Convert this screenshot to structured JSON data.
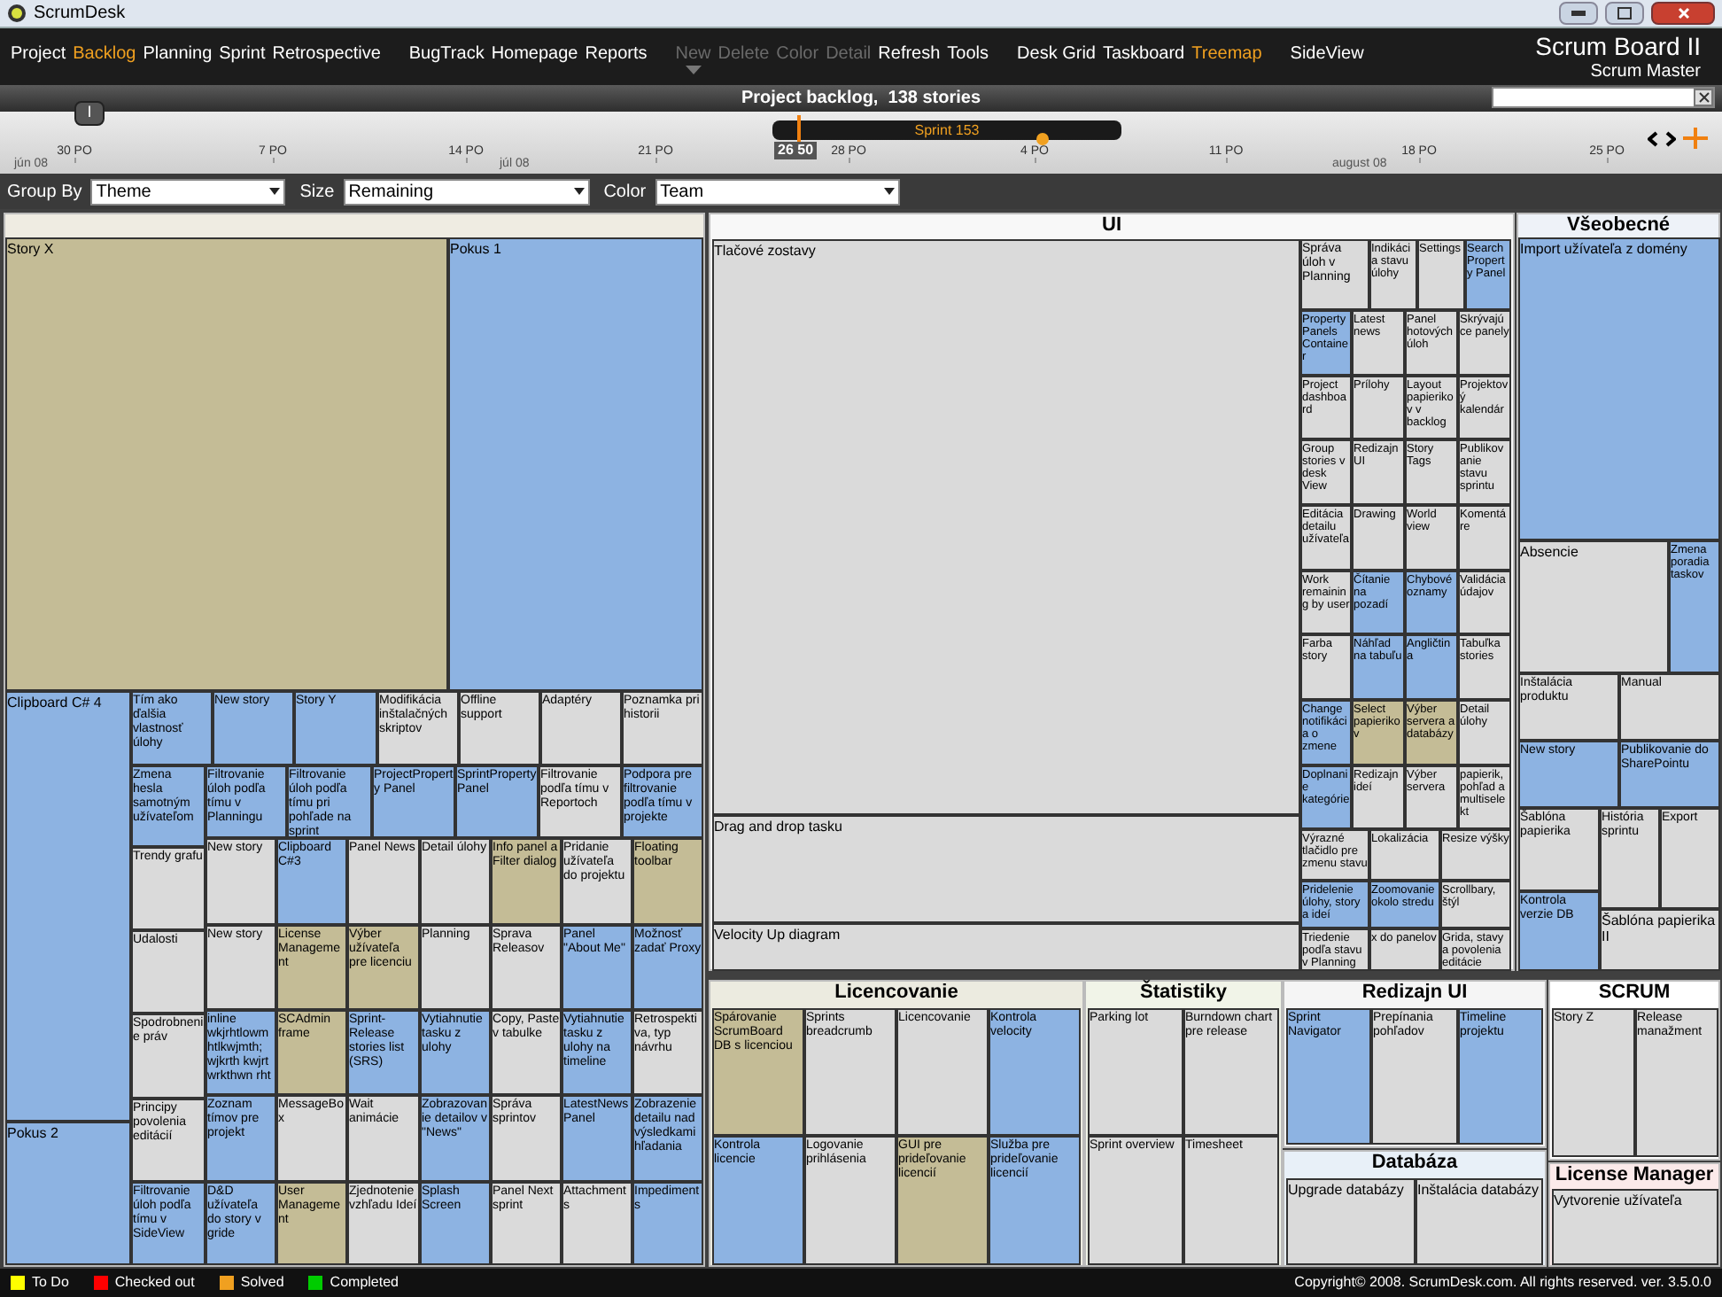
{
  "window": {
    "title": "ScrumDesk"
  },
  "menu": {
    "groups": [
      [
        {
          "label": "Project",
          "selected": false,
          "disabled": false
        },
        {
          "label": "Backlog",
          "selected": true,
          "disabled": false
        },
        {
          "label": "Planning",
          "selected": false,
          "disabled": false
        },
        {
          "label": "Sprint",
          "selected": false,
          "disabled": false
        },
        {
          "label": "Retrospective",
          "selected": false,
          "disabled": false
        }
      ],
      [
        {
          "label": "BugTrack",
          "selected": false,
          "disabled": false
        },
        {
          "label": "Homepage",
          "selected": false,
          "disabled": false
        },
        {
          "label": "Reports",
          "selected": false,
          "disabled": false
        }
      ],
      [
        {
          "label": "New",
          "selected": false,
          "disabled": true
        },
        {
          "label": "Delete",
          "selected": false,
          "disabled": true
        },
        {
          "label": "Color",
          "selected": false,
          "disabled": true
        },
        {
          "label": "Detail",
          "selected": false,
          "disabled": true
        },
        {
          "label": "Refresh",
          "selected": false,
          "disabled": false
        },
        {
          "label": "Tools",
          "selected": false,
          "disabled": false
        }
      ],
      [
        {
          "label": "Desk Grid",
          "selected": false,
          "disabled": false
        },
        {
          "label": "Taskboard",
          "selected": false,
          "disabled": false
        },
        {
          "label": "Treemap",
          "selected": true,
          "disabled": false
        }
      ],
      [
        {
          "label": "SideView",
          "selected": false,
          "disabled": false
        }
      ]
    ]
  },
  "board": {
    "title": "Scrum Board II",
    "role": "Scrum Master"
  },
  "backlog_header": {
    "title": "Project backlog,  138 stories"
  },
  "timeline": {
    "dates": [
      "30 PO",
      "7 PO",
      "14 PO",
      "21 PO",
      "28 PO",
      "4 PO",
      "11 PO",
      "18 PO",
      "25 PO"
    ],
    "months": [
      "jún 08",
      "júl 08",
      "august 08"
    ],
    "today": "26 50",
    "sprint": "Sprint 153",
    "handle": "I"
  },
  "toolbar": [
    {
      "label": "Group By",
      "value": "Theme"
    },
    {
      "label": "Size",
      "value": "Remaining"
    },
    {
      "label": "Color",
      "value": "Team"
    }
  ],
  "treemap": {
    "groups": [
      {
        "tiles": [
          {
            "label": "Story X",
            "color": "#c4bc96"
          },
          {
            "label": "Pokus 1",
            "color": "#8db3e2"
          },
          {
            "label": "Clipboard C# 4",
            "color": "#8db3e2"
          },
          {
            "label": "Pokus 2",
            "color": "#8db3e2"
          },
          {
            "label": "Tím ako ďalšia vlastnosť úlohy",
            "color": "#8db3e2"
          },
          {
            "label": "New story",
            "color": "#8db3e2"
          },
          {
            "label": "Story Y",
            "color": "#8db3e2"
          },
          {
            "label": "Modifikácia inštalačných skriptov",
            "color": "#dadada"
          },
          {
            "label": "Offline support",
            "color": "#dadada"
          },
          {
            "label": "Adaptéry",
            "color": "#dadada"
          },
          {
            "label": "Poznamka pri historii",
            "color": "#dadada"
          },
          {
            "label": "Zmena hesla samotným užívateľom",
            "color": "#8db3e2"
          },
          {
            "label": "Filtrovanie úloh podľa tímu v Planningu",
            "color": "#8db3e2"
          },
          {
            "label": "Filtrovanie úloh podľa tímu pri pohľade na sprint",
            "color": "#8db3e2"
          },
          {
            "label": "ProjectProperty Panel",
            "color": "#8db3e2"
          },
          {
            "label": "SprintProperty Panel",
            "color": "#8db3e2"
          },
          {
            "label": "Filtrovanie podľa tímu v Reportoch",
            "color": "#dadada"
          },
          {
            "label": "Podpora pre filtrovanie podľa tímu v projekte",
            "color": "#8db3e2"
          },
          {
            "label": "Trendy grafu",
            "color": "#dadada"
          },
          {
            "label": "Udalosti",
            "color": "#dadada"
          },
          {
            "label": "Spodrobnenie práv",
            "color": "#dadada"
          },
          {
            "label": "Principy povolenia editácií",
            "color": "#dadada"
          },
          {
            "label": "Filtrovanie úloh podľa tímu v SideView",
            "color": "#8db3e2"
          },
          {
            "label": "New story",
            "color": "#dadada"
          },
          {
            "label": "Clipboard C#3",
            "color": "#8db3e2"
          },
          {
            "label": "Panel News",
            "color": "#dadada"
          },
          {
            "label": "Detail úlohy",
            "color": "#dadada"
          },
          {
            "label": "Info panel a Filter dialog",
            "color": "#c4bc96"
          },
          {
            "label": "Pridanie užívateľa do projektu",
            "color": "#dadada"
          },
          {
            "label": "Floating toolbar",
            "color": "#c4bc96"
          },
          {
            "label": "New story",
            "color": "#dadada"
          },
          {
            "label": "License Management",
            "color": "#c4bc96"
          },
          {
            "label": "Výber užívateľa pre licenciu",
            "color": "#c4bc96"
          },
          {
            "label": "Planning",
            "color": "#dadada"
          },
          {
            "label": "Sprava Releasov",
            "color": "#dadada"
          },
          {
            "label": "Panel \"About Me\"",
            "color": "#8db3e2"
          },
          {
            "label": "Možnosť zadať Proxy",
            "color": "#8db3e2"
          },
          {
            "label": "inline wkjrhtlowmhtlkwjmth; wjkrth kwjrt wrkthwn rht",
            "color": "#8db3e2"
          },
          {
            "label": "SCAdmin frame",
            "color": "#c4bc96"
          },
          {
            "label": "Sprint-Release stories list (SRS)",
            "color": "#8db3e2"
          },
          {
            "label": "Vytiahnutie tasku z ulohy",
            "color": "#8db3e2"
          },
          {
            "label": "Copy, Paste v tabulke",
            "color": "#dadada"
          },
          {
            "label": "Vytiahnutie tasku z ulohy na timeline",
            "color": "#8db3e2"
          },
          {
            "label": "Retrospektiva, typ návrhu",
            "color": "#dadada"
          },
          {
            "label": "Zoznam tímov pre projekt",
            "color": "#8db3e2"
          },
          {
            "label": "MessageBox",
            "color": "#dadada"
          },
          {
            "label": "Wait animácie",
            "color": "#dadada"
          },
          {
            "label": "Zobrazovanie detailov v \"News\"",
            "color": "#8db3e2"
          },
          {
            "label": "Správa sprintov",
            "color": "#dadada"
          },
          {
            "label": "LatestNewsPanel",
            "color": "#8db3e2"
          },
          {
            "label": "Zobrazenie detailu nad výsledkami hľadania",
            "color": "#8db3e2"
          },
          {
            "label": "D&D užívateľa do story v gride",
            "color": "#8db3e2"
          },
          {
            "label": "User Management",
            "color": "#c4bc96"
          },
          {
            "label": "Zjednotenie vzhľadu Ideí",
            "color": "#dadada"
          },
          {
            "label": "Splash Screen",
            "color": "#8db3e2"
          },
          {
            "label": "Panel Next sprint",
            "color": "#dadada"
          },
          {
            "label": "Attachments",
            "color": "#dadada"
          },
          {
            "label": "Impediments",
            "color": "#8db3e2"
          }
        ]
      },
      {
        "title": "UI",
        "tiles": [
          {
            "label": "Tlačové zostavy",
            "color": "#dadada"
          },
          {
            "label": "Drag and drop tasku",
            "color": "#dadada"
          },
          {
            "label": "Velocity Up diagram",
            "color": "#dadada"
          },
          {
            "label": "Správa úloh v Planning",
            "color": "#dadada"
          },
          {
            "label": "Indikácia stavu úlohy",
            "color": "#dadada"
          },
          {
            "label": "Settings",
            "color": "#dadada"
          },
          {
            "label": "Search Property Panel",
            "color": "#8db3e2"
          },
          {
            "label": "Property Panels Container",
            "color": "#8db3e2"
          },
          {
            "label": "Latest news",
            "color": "#dadada"
          },
          {
            "label": "Panel hotových úloh",
            "color": "#dadada"
          },
          {
            "label": "Skrývajúce panely",
            "color": "#dadada"
          },
          {
            "label": "Project dashboard",
            "color": "#dadada"
          },
          {
            "label": "Prílohy",
            "color": "#dadada"
          },
          {
            "label": "Layout papierikov v backlog",
            "color": "#dadada"
          },
          {
            "label": "Projektový kalendár",
            "color": "#dadada"
          },
          {
            "label": "Group stories v desk View",
            "color": "#dadada"
          },
          {
            "label": "Redizajn UI",
            "color": "#dadada"
          },
          {
            "label": "Story Tags",
            "color": "#dadada"
          },
          {
            "label": "Publikovanie stavu sprintu",
            "color": "#dadada"
          },
          {
            "label": "Editácia detailu užívateľa",
            "color": "#dadada"
          },
          {
            "label": "Drawing",
            "color": "#dadada"
          },
          {
            "label": "World view",
            "color": "#dadada"
          },
          {
            "label": "Komentáre",
            "color": "#dadada"
          },
          {
            "label": "Work remaining by user",
            "color": "#dadada"
          },
          {
            "label": "Čítanie na pozadí",
            "color": "#8db3e2"
          },
          {
            "label": "Chybové oznamy",
            "color": "#8db3e2"
          },
          {
            "label": "Validácia údajov",
            "color": "#dadada"
          },
          {
            "label": "Farba story",
            "color": "#dadada"
          },
          {
            "label": "Náhľad na tabuľu",
            "color": "#8db3e2"
          },
          {
            "label": "Angličtina",
            "color": "#8db3e2"
          },
          {
            "label": "Tabuľka stories",
            "color": "#dadada"
          },
          {
            "label": "Change notifikácia o zmene",
            "color": "#8db3e2"
          },
          {
            "label": "Select papierikov",
            "color": "#c4bc96"
          },
          {
            "label": "Výber servera a databázy",
            "color": "#c4bc96"
          },
          {
            "label": "Detail úlohy",
            "color": "#dadada"
          },
          {
            "label": "Doplnanie kategórie",
            "color": "#8db3e2"
          },
          {
            "label": "Redizajn ideí",
            "color": "#dadada"
          },
          {
            "label": "Výber servera",
            "color": "#dadada"
          },
          {
            "label": "papierik, pohľad a multiselekt",
            "color": "#dadada"
          },
          {
            "label": "Výrazné tlačidlo pre zmenu stavu",
            "color": "#dadada"
          },
          {
            "label": "Lokalizácia",
            "color": "#dadada"
          },
          {
            "label": "Resize výšky",
            "color": "#dadada"
          },
          {
            "label": "Pridelenie úlohy, story a ideí",
            "color": "#8db3e2"
          },
          {
            "label": "Zoomovanie okolo stredu",
            "color": "#8db3e2"
          },
          {
            "label": "Scrollbary, štýl",
            "color": "#dadada"
          },
          {
            "label": "Triedenie podľa stavu v Planning",
            "color": "#dadada"
          },
          {
            "label": "x do panelov",
            "color": "#dadada"
          },
          {
            "label": "Grida, stavy a povolenia editácie",
            "color": "#dadada"
          }
        ]
      },
      {
        "title": "Všeobecné",
        "tiles": [
          {
            "label": "Import užívateľa z domény",
            "color": "#8db3e2"
          },
          {
            "label": "Absencie",
            "color": "#dadada"
          },
          {
            "label": "Zmena poradia taskov",
            "color": "#8db3e2"
          },
          {
            "label": "Inštalácia produktu",
            "color": "#dadada"
          },
          {
            "label": "Manual",
            "color": "#dadada"
          },
          {
            "label": "New story",
            "color": "#8db3e2"
          },
          {
            "label": "Publikovanie do SharePointu",
            "color": "#8db3e2"
          },
          {
            "label": "Šablóna papierika",
            "color": "#dadada"
          },
          {
            "label": "História sprintu",
            "color": "#dadada"
          },
          {
            "label": "Export",
            "color": "#dadada"
          },
          {
            "label": "Kontrola verzie DB",
            "color": "#8db3e2"
          },
          {
            "label": "Šablóna papierika II",
            "color": "#dadada"
          }
        ]
      },
      {
        "title": "Licencovanie",
        "tiles": [
          {
            "label": "Spárovanie ScrumBoard DB s licenciou",
            "color": "#c4bc96"
          },
          {
            "label": "Sprints breadcrumb",
            "color": "#dadada"
          },
          {
            "label": "Licencovanie",
            "color": "#dadada"
          },
          {
            "label": "Kontrola velocity",
            "color": "#8db3e2"
          },
          {
            "label": "Kontrola licencie",
            "color": "#8db3e2"
          },
          {
            "label": "Logovanie prihlásenia",
            "color": "#dadada"
          },
          {
            "label": "GUI pre prideľovanie licencií",
            "color": "#c4bc96"
          },
          {
            "label": "Služba pre prideľovanie licencií",
            "color": "#8db3e2"
          }
        ]
      },
      {
        "title": "Štatistiky",
        "tiles": [
          {
            "label": "Parking lot",
            "color": "#dadada"
          },
          {
            "label": "Burndown chart pre release",
            "color": "#dadada"
          },
          {
            "label": "Sprint overview",
            "color": "#dadada"
          },
          {
            "label": "Timesheet",
            "color": "#dadada"
          }
        ]
      },
      {
        "title": "Redizajn UI",
        "tiles": [
          {
            "label": "Sprint Navigator",
            "color": "#8db3e2"
          },
          {
            "label": "Prepínania pohľadov",
            "color": "#dadada"
          },
          {
            "label": "Timeline projektu",
            "color": "#8db3e2"
          }
        ]
      },
      {
        "title": "Databáza",
        "tiles": [
          {
            "label": "Upgrade databázy",
            "color": "#dadada"
          },
          {
            "label": "Inštalácia databázy",
            "color": "#dadada"
          }
        ]
      },
      {
        "title": "SCRUM",
        "tiles": [
          {
            "label": "Story Z",
            "color": "#dadada"
          },
          {
            "label": "Release manažment",
            "color": "#dadada"
          }
        ]
      },
      {
        "title": "License Manager",
        "tiles": [
          {
            "label": "Vytvorenie užívateľa",
            "color": "#dadada"
          }
        ]
      }
    ]
  },
  "legend": [
    {
      "label": "To Do",
      "color": "#ffff00"
    },
    {
      "label": "Checked out",
      "color": "#ff0000"
    },
    {
      "label": "Solved",
      "color": "#f0a020"
    },
    {
      "label": "Completed",
      "color": "#00cc00"
    }
  ],
  "copyright": "Copyright© 2008. ScrumDesk.com. All rights reserved. ver. 3.5.0.0"
}
